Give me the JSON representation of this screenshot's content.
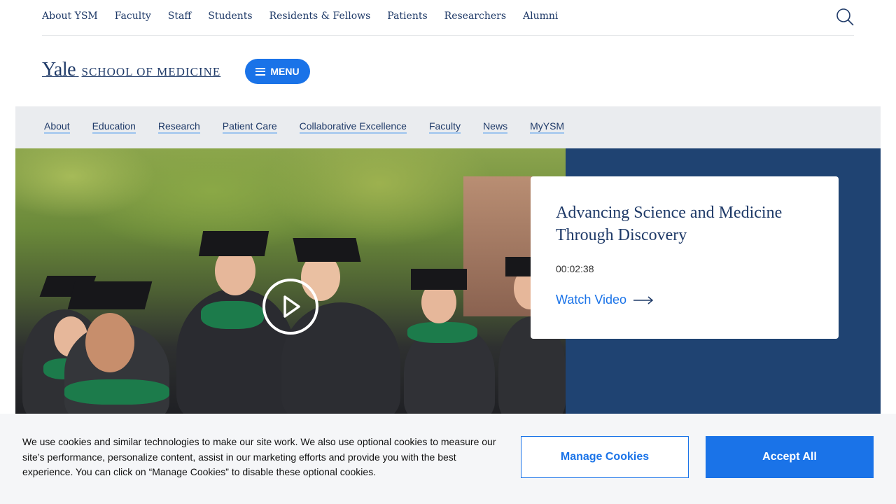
{
  "utility_nav": {
    "links": [
      "About YSM",
      "Faculty",
      "Staff",
      "Students",
      "Residents & Fellows",
      "Patients",
      "Researchers",
      "Alumni"
    ],
    "search_icon": "search-icon"
  },
  "brand": {
    "logo_yale": "Yale",
    "logo_school": "SCHOOL OF MEDICINE",
    "menu_label": "MENU"
  },
  "section_nav": {
    "items": [
      "About",
      "Education",
      "Research",
      "Patient Care",
      "Collaborative Excellence",
      "Faculty",
      "News",
      "MyYSM"
    ]
  },
  "hero": {
    "title": "Advancing Science and Medicine Through Discovery",
    "duration": "00:02:38",
    "cta": "Watch Video",
    "panel_color": "#1f4372"
  },
  "cookie_banner": {
    "text": "We use cookies and similar technologies to make our site work. We also use optional cookies to measure our site’s performance, personalize content, assist in our marketing efforts and provide you with the best experience. You can click on “Manage Cookies” to disable these optional cookies.",
    "manage_label": "Manage Cookies",
    "accept_label": "Accept All"
  },
  "colors": {
    "brand_navy": "#1f3a68",
    "accent_blue": "#1a73e8"
  }
}
